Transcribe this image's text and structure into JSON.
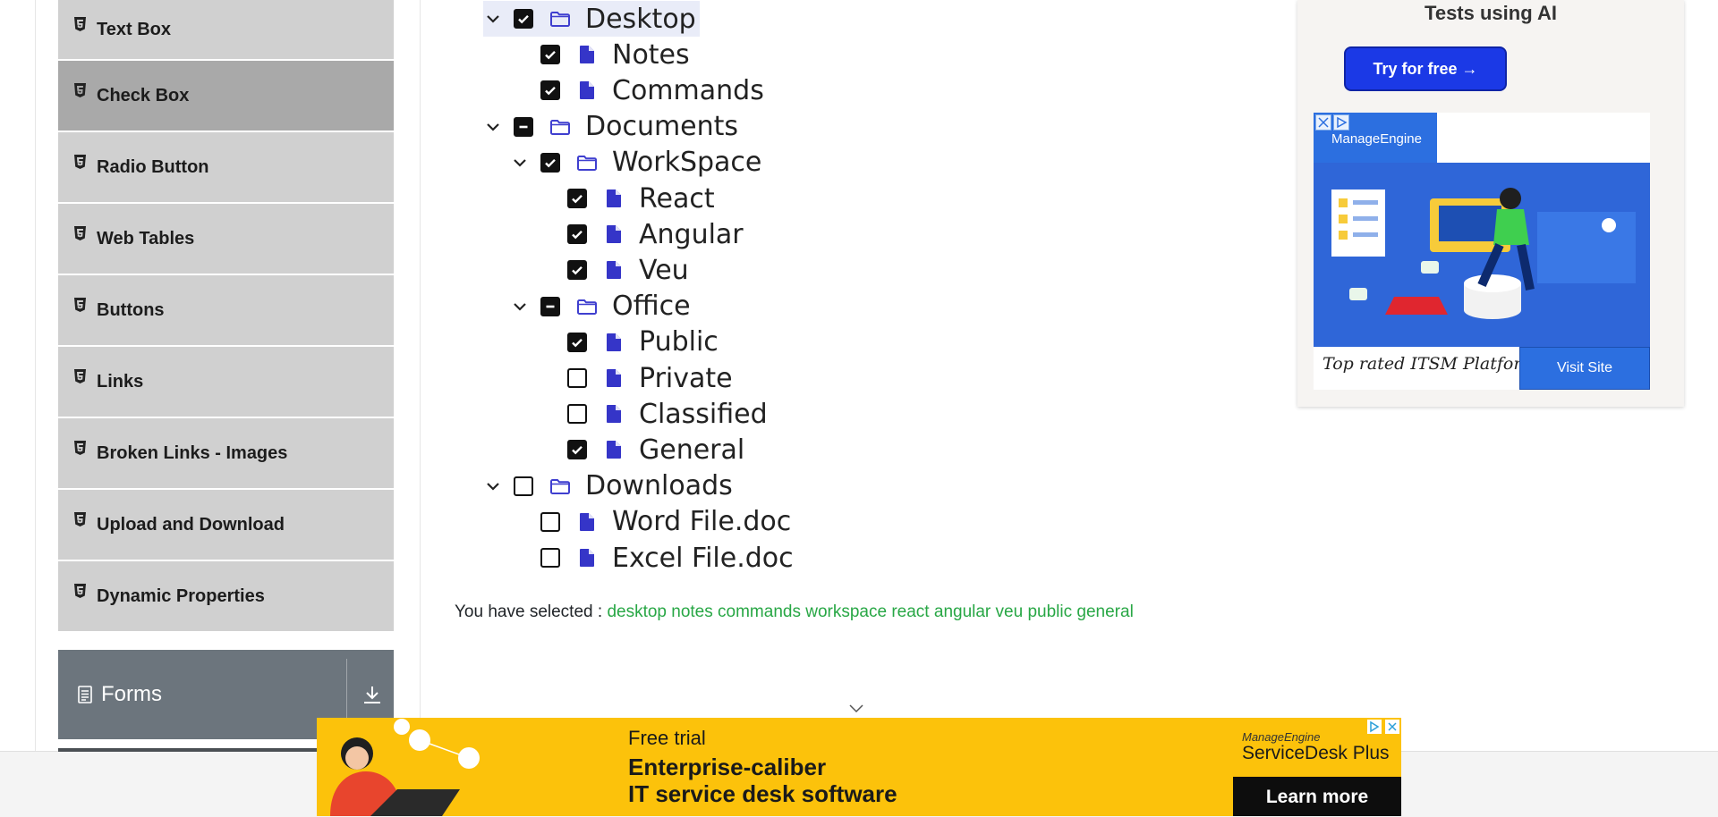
{
  "sidebar": {
    "items": [
      {
        "label": "Text Box",
        "active": false
      },
      {
        "label": "Check Box",
        "active": true
      },
      {
        "label": "Radio Button",
        "active": false
      },
      {
        "label": "Web Tables",
        "active": false
      },
      {
        "label": "Buttons",
        "active": false
      },
      {
        "label": "Links",
        "active": false
      },
      {
        "label": "Broken Links - Images",
        "active": false
      },
      {
        "label": "Upload and Download",
        "active": false
      },
      {
        "label": "Dynamic Properties",
        "active": false
      }
    ],
    "forms_group": {
      "label": "Forms"
    }
  },
  "tree": {
    "desktop": {
      "label": "Desktop",
      "state": "checked",
      "expanded": true
    },
    "notes": {
      "label": "Notes",
      "state": "checked"
    },
    "commands": {
      "label": "Commands",
      "state": "checked"
    },
    "documents": {
      "label": "Documents",
      "state": "half",
      "expanded": true
    },
    "workspace": {
      "label": "WorkSpace",
      "state": "checked",
      "expanded": true
    },
    "react": {
      "label": "React",
      "state": "checked"
    },
    "angular": {
      "label": "Angular",
      "state": "checked"
    },
    "veu": {
      "label": "Veu",
      "state": "checked"
    },
    "office": {
      "label": "Office",
      "state": "half",
      "expanded": true
    },
    "public": {
      "label": "Public",
      "state": "checked"
    },
    "private": {
      "label": "Private",
      "state": "unchecked"
    },
    "classified": {
      "label": "Classified",
      "state": "unchecked"
    },
    "general": {
      "label": "General",
      "state": "checked"
    },
    "downloads": {
      "label": "Downloads",
      "state": "unchecked",
      "expanded": true
    },
    "word": {
      "label": "Word File.doc",
      "state": "unchecked"
    },
    "excel": {
      "label": "Excel File.doc",
      "state": "unchecked"
    }
  },
  "result": {
    "prefix": "You have selected :",
    "items": [
      "desktop",
      "notes",
      "commands",
      "workspace",
      "react",
      "angular",
      "veu",
      "public",
      "general"
    ]
  },
  "ads": {
    "top": {
      "heading": "Tests using AI",
      "cta": "Try for free →",
      "brand": "ManageEngine",
      "tagline": "Top rated ITSM Platform",
      "visit": "Visit Site"
    },
    "bottom": {
      "line1": "Free trial",
      "line2": "Enterprise-caliber",
      "line3": "IT service desk software",
      "brand_small": "ManageEngine",
      "brand_large": "ServiceDesk Plus",
      "cta": "Learn more"
    }
  },
  "colors": {
    "sidebar_item": "#d0d0d0",
    "sidebar_active": "#a9a9a9",
    "forms_group": "#6c757d",
    "selected_text": "#28a745",
    "folder_icon": "#3f3fcf",
    "file_icon": "#3535c8",
    "ad_yellow": "#fcc20b",
    "ad_blue": "#2c6fe0"
  }
}
